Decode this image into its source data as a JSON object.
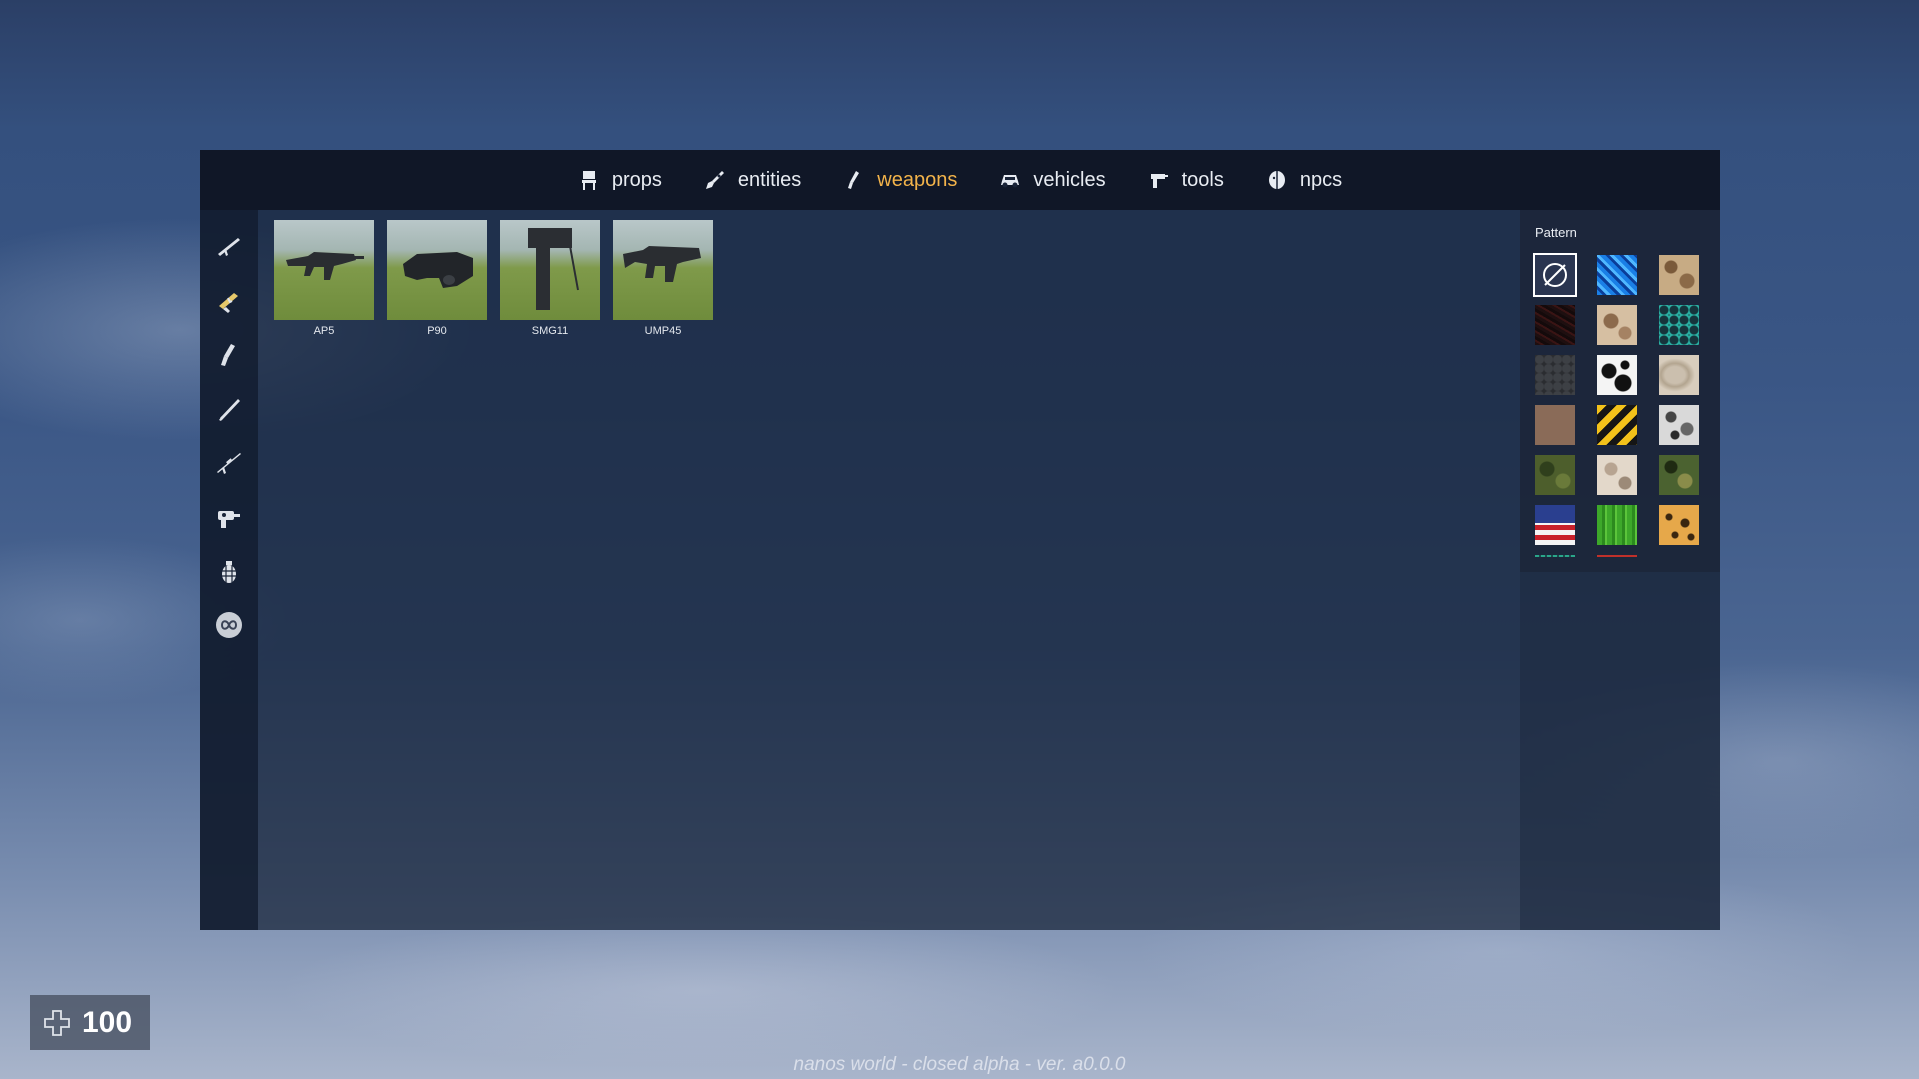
{
  "nav": {
    "tabs": [
      {
        "label": "props",
        "icon": "chair-icon"
      },
      {
        "label": "entities",
        "icon": "rocket-icon"
      },
      {
        "label": "weapons",
        "icon": "pistol-icon",
        "active": true
      },
      {
        "label": "vehicles",
        "icon": "car-icon"
      },
      {
        "label": "tools",
        "icon": "toolgun-icon"
      },
      {
        "label": "npcs",
        "icon": "head-icon"
      }
    ],
    "active_color": "#f2b34a"
  },
  "rail": {
    "items": [
      {
        "icon": "rifle-icon"
      },
      {
        "icon": "smg-icon"
      },
      {
        "icon": "pistol-icon"
      },
      {
        "icon": "shotgun-icon"
      },
      {
        "icon": "sniper-icon"
      },
      {
        "icon": "special-weapon-icon"
      },
      {
        "icon": "grenade-icon"
      },
      {
        "icon": "infinity-icon"
      }
    ]
  },
  "weapons": [
    {
      "label": "AP5"
    },
    {
      "label": "P90"
    },
    {
      "label": "SMG11"
    },
    {
      "label": "UMP45"
    }
  ],
  "pattern": {
    "title": "Pattern",
    "swatches": [
      {
        "name": "none",
        "selected": true
      },
      {
        "name": "blue-digital-camo"
      },
      {
        "name": "desert-camo"
      },
      {
        "name": "dark-red-noise"
      },
      {
        "name": "tan-camo"
      },
      {
        "name": "teal-hexagon"
      },
      {
        "name": "dark-hexagon"
      },
      {
        "name": "white-black-splatter"
      },
      {
        "name": "beige-swirl"
      },
      {
        "name": "brown-leather"
      },
      {
        "name": "yellow-black-stripes"
      },
      {
        "name": "urban-camo"
      },
      {
        "name": "green-camo"
      },
      {
        "name": "light-desert-camo"
      },
      {
        "name": "woodland-camo"
      },
      {
        "name": "usa-flag"
      },
      {
        "name": "green-stripes"
      },
      {
        "name": "leopard"
      }
    ]
  },
  "hud": {
    "health": "100"
  },
  "footer": {
    "text": "nanos world - closed alpha - ver. a0.0.0"
  }
}
